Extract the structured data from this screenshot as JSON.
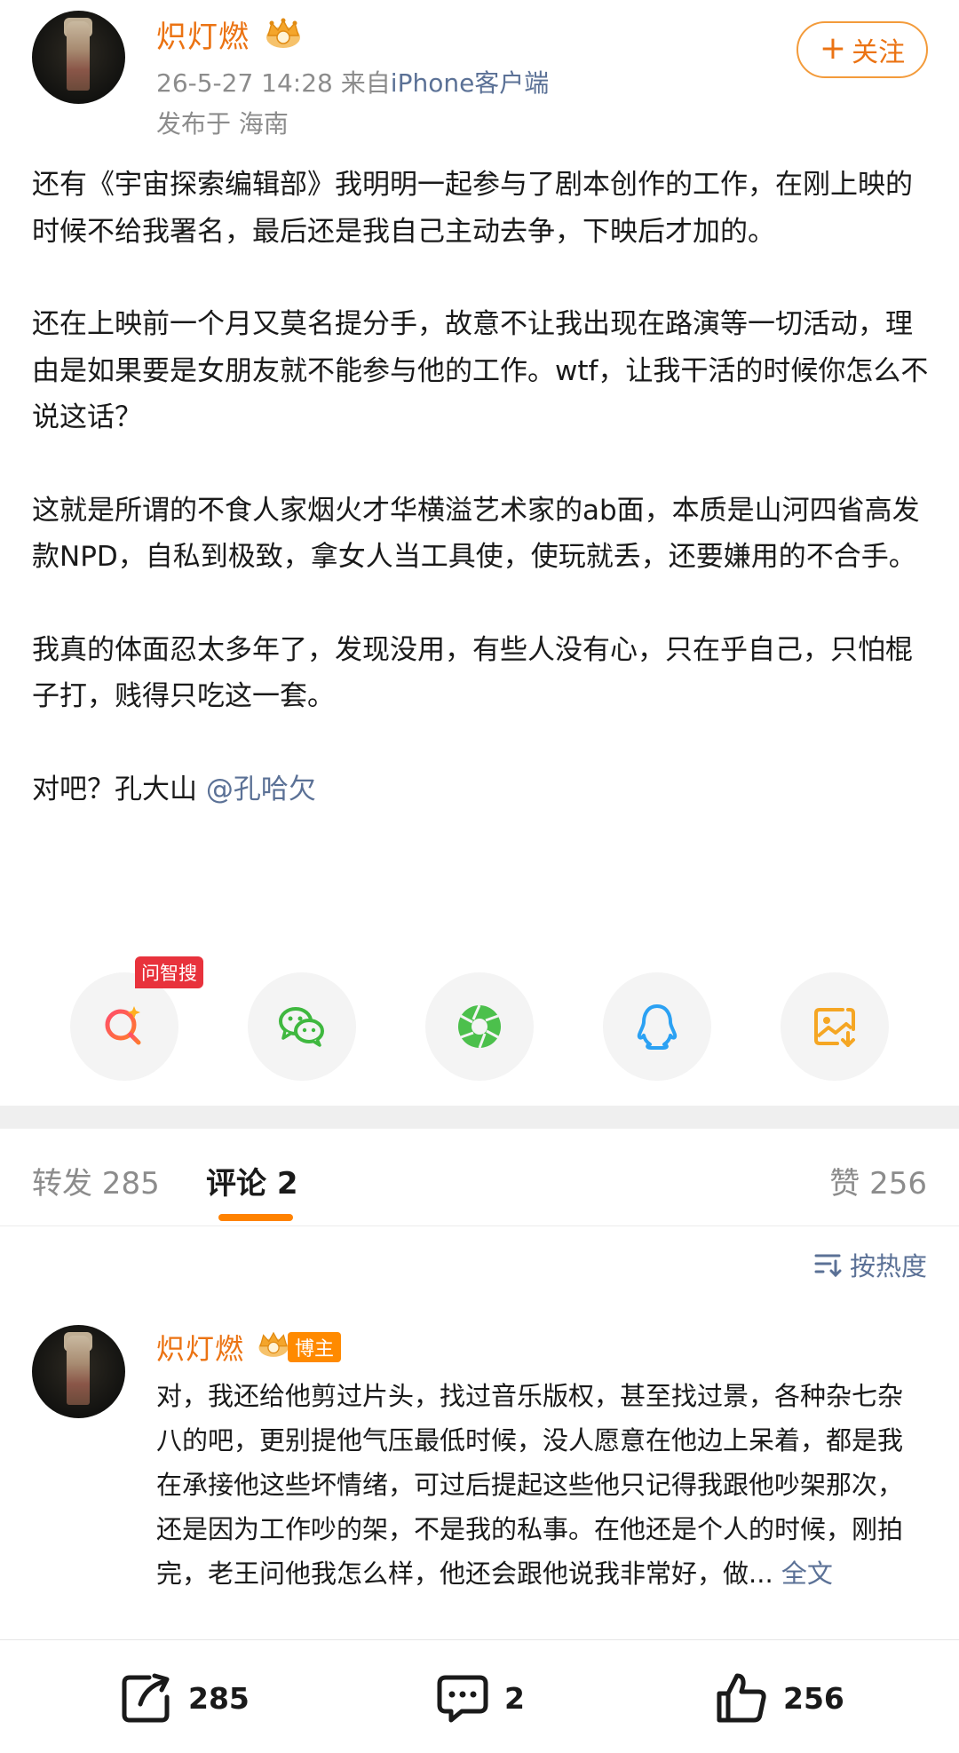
{
  "post": {
    "username": "炽灯燃",
    "timestamp": "26-5-27 14:28",
    "source_prefix": "来自",
    "source_client": "iPhone客户端",
    "location": "发布于 海南",
    "follow_label": "关注",
    "paragraphs": [
      "还有《宇宙探索编辑部》我明明一起参与了剧本创作的工作，在刚上映的时候不给我署名，最后还是我自己主动去争，下映后才加的。",
      "还在上映前一个月又莫名提分手，故意不让我出现在路演等一切活动，理由是如果要是女朋友就不能参与他的工作。wtf，让我干活的时候你怎么不说这话？",
      "这就是所谓的不食人家烟火才华横溢艺术家的ab面，本质是山河四省高发款NPD，自私到极致，拿女人当工具使，使玩就丢，还要嫌用的不合手。",
      "我真的体面忍太多年了，发现没用，有些人没有心，只在乎自己，只怕棍子打，贱得只吃这一套。"
    ],
    "last_line_prefix": "对吧？孔大山",
    "mention": "@孔哈欠"
  },
  "share": {
    "badge": "问智搜",
    "icons": [
      "search-ai-icon",
      "wechat-icon",
      "moments-icon",
      "qq-icon",
      "save-image-icon"
    ]
  },
  "tabs": {
    "repost": "转发 285",
    "comments": "评论 2",
    "likes": "赞 256"
  },
  "sort_label": "按热度",
  "comment": {
    "username": "炽灯燃",
    "badge": "博主",
    "text": "对，我还给他剪过片头，找过音乐版权，甚至找过景，各种杂七杂八的吧，更别提他气压最低时候，没人愿意在他边上呆着，都是我在承接他这些坏情绪，可过后提起这些他只记得我跟他吵架那次，还是因为工作吵的架，不是我的私事。在他还是个人的时候，刚拍完，老王问他我怎么样，他还会跟他说我非常好，做...",
    "fulltext": "全文"
  },
  "bottom_bar": {
    "reposts": "285",
    "comments": "2",
    "likes": "256"
  },
  "colors": {
    "username": "#eb7313",
    "link": "#5b7196",
    "accent": "#ff8200",
    "badge_red": "#e8323c"
  }
}
